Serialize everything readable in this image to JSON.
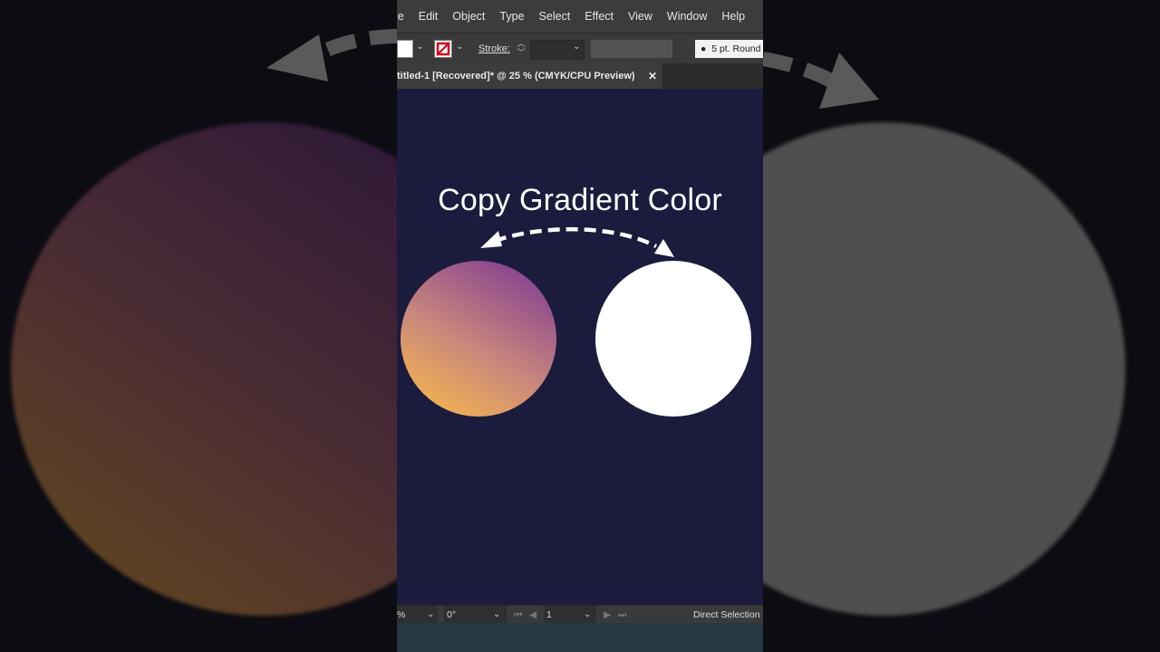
{
  "menu": {
    "items": [
      "le",
      "Edit",
      "Object",
      "Type",
      "Select",
      "Effect",
      "View",
      "Window",
      "Help"
    ]
  },
  "control_bar": {
    "stroke_label": "Stroke:",
    "brush_label": "5 pt. Round"
  },
  "document_tab": {
    "title": "titled-1 [Recovered]* @ 25 % (CMYK/CPU Preview)",
    "close_glyph": "✕"
  },
  "canvas": {
    "headline": "Copy Gradient Color",
    "background_color": "#1b1c3d",
    "gradient_colors": [
      "#fdbd45",
      "#c8877c",
      "#7a3396"
    ],
    "target_color": "#ffffff"
  },
  "status_bar": {
    "zoom_fragment": "%",
    "rotation": "0°",
    "artboard": "1",
    "tool": "Direct Selection"
  },
  "icons": {
    "swap": "dashed-double-arrow-icon",
    "chevron": "chevron-down-icon"
  }
}
